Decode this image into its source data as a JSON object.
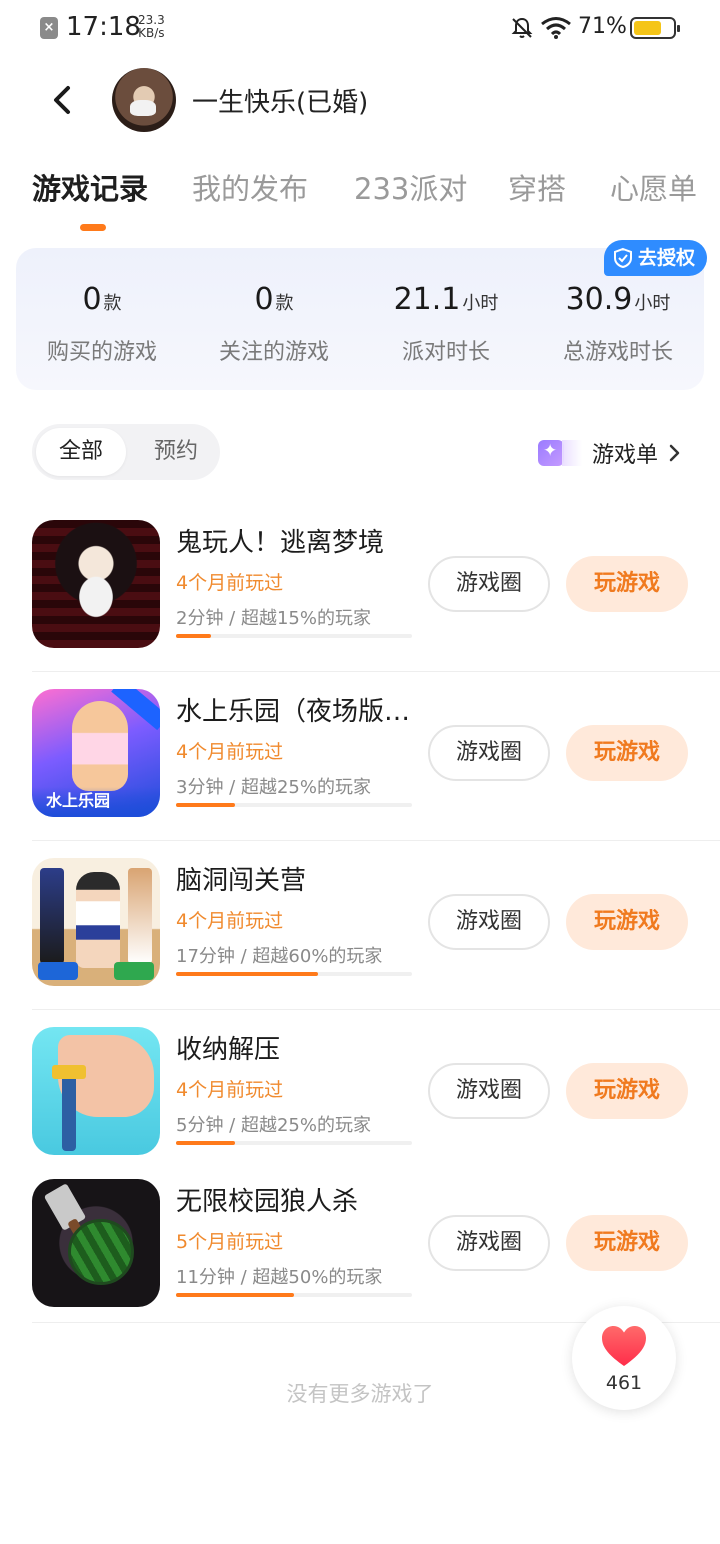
{
  "status_bar": {
    "time": "17:18",
    "net_speed_value": "23.3",
    "net_speed_unit": "KB/s",
    "battery": "71%",
    "battery_level": 0.71
  },
  "header": {
    "username": "一生快乐(已婚)"
  },
  "tabs": [
    {
      "label": "游戏记录",
      "active": true
    },
    {
      "label": "我的发布",
      "active": false
    },
    {
      "label": "233派对",
      "active": false
    },
    {
      "label": "穿搭",
      "active": false
    },
    {
      "label": "心愿单",
      "active": false
    }
  ],
  "stats": {
    "auth_badge": "去授权",
    "items": [
      {
        "value": "0",
        "unit": "款",
        "label": "购买的游戏"
      },
      {
        "value": "0",
        "unit": "款",
        "label": "关注的游戏"
      },
      {
        "value": "21.1",
        "unit": "小时",
        "label": "派对时长"
      },
      {
        "value": "30.9",
        "unit": "小时",
        "label": "总游戏时长"
      }
    ]
  },
  "filter": {
    "options": [
      "全部",
      "预约"
    ],
    "selected": "全部",
    "gamelist_label": "游戏单"
  },
  "games": [
    {
      "title": "鬼玩人！逃离梦境",
      "played": "4个月前玩过",
      "stat": "2分钟 / 超越15%的玩家",
      "percentile": 15,
      "btn_circle": "游戏圈",
      "btn_play": "玩游戏",
      "icon": "ghost-girl-game-icon"
    },
    {
      "title": "水上乐园（夜场版…",
      "played": "4个月前玩过",
      "stat": "3分钟 / 超越25%的玩家",
      "percentile": 25,
      "btn_circle": "游戏圈",
      "btn_play": "玩游戏",
      "icon": "water-park-game-icon",
      "icon_text": "水上乐园"
    },
    {
      "title": "脑洞闯关营",
      "played": "4个月前玩过",
      "stat": "17分钟 / 超越60%的玩家",
      "percentile": 60,
      "btn_circle": "游戏圈",
      "btn_play": "玩游戏",
      "icon": "dress-up-game-icon"
    },
    {
      "title": "收纳解压",
      "played": "4个月前玩过",
      "stat": "5分钟 / 超越25%的玩家",
      "percentile": 25,
      "btn_circle": "游戏圈",
      "btn_play": "玩游戏",
      "icon": "foot-clamp-game-icon"
    },
    {
      "title": "无限校园狼人杀",
      "played": "5个月前玩过",
      "stat": "11分钟 / 超越50%的玩家",
      "percentile": 50,
      "btn_circle": "游戏圈",
      "btn_play": "玩游戏",
      "icon": "watermelon-knife-game-icon"
    }
  ],
  "footer": {
    "no_more": "没有更多游戏了",
    "like_count": "461"
  },
  "colors": {
    "accent": "#ff7a1a",
    "played_text": "#f08a2e",
    "play_button_bg": "#ffe9da",
    "auth_badge": "#2f8cff"
  }
}
